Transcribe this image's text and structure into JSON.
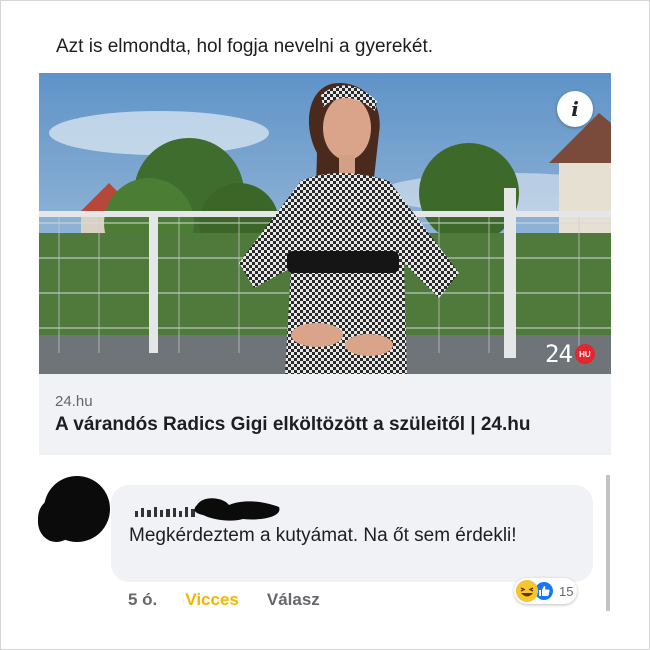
{
  "post": {
    "text": "Azt is elmondta, hol fogja nevelni a gyerekét."
  },
  "link_preview": {
    "domain": "24.hu",
    "title": "A várandós Radics Gigi elköltözött a szüleitől | 24.hu",
    "watermark": "24",
    "watermark_badge": "HU",
    "info_icon": "i"
  },
  "comment": {
    "text": "Megkérdeztem a kutyámat. Na őt sem érdekli!",
    "reactions": {
      "icons": [
        "haha-icon",
        "like-icon"
      ],
      "count": "15"
    },
    "actions": {
      "time": "5 ó.",
      "react_label": "Vicces",
      "reply_label": "Válasz"
    }
  },
  "colors": {
    "haha_action": "#f2b600",
    "like_blue": "#1877f2",
    "bubble_bg": "#f0f2f5",
    "badge_red": "#e3262f"
  }
}
